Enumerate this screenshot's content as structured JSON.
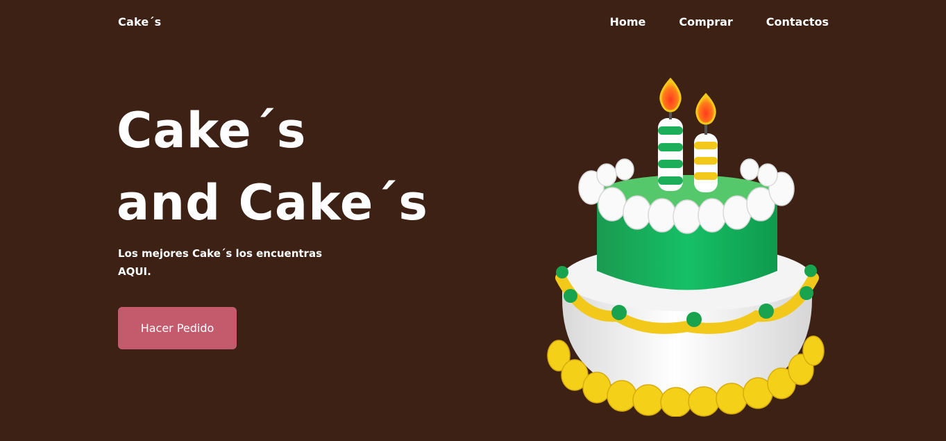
{
  "header": {
    "logo": "Cake´s",
    "nav": [
      "Home",
      "Comprar",
      "Contactos"
    ]
  },
  "hero": {
    "title_line1": "Cake´s",
    "title_line2": "and Cake´s",
    "subtitle_line1": "Los mejores Cake´s los encuentras",
    "subtitle_line2": "AQUI.",
    "cta_label": "Hacer Pedido"
  },
  "colors": {
    "background": "#3d2115",
    "button": "#c35b6d",
    "text": "#ffffff",
    "cake_green": "#12b85f",
    "cake_yellow": "#f4d018"
  }
}
